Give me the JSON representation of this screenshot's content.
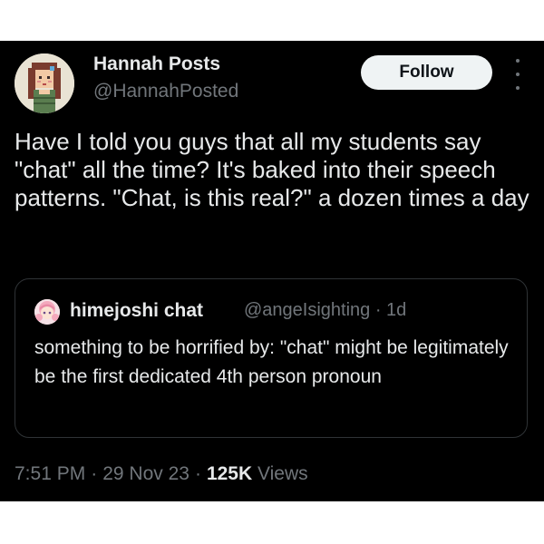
{
  "author": {
    "name": "Hannah Posts",
    "handle": "@HannahPosted",
    "avatar_icon": "pixel-art-avatar-icon"
  },
  "follow_label": "Follow",
  "more_icon": "more-vertical-icon",
  "text": "Have I told you guys that all my students say \"chat\" all the time? It's baked into their speech patterns. \"Chat, is this real?\" a dozen times a day",
  "quote": {
    "name": "himejoshi chat",
    "handle_time": "@angeIsighting · 1d",
    "text": "something to be horrified by: \"chat\" might be legitimately be the first dedicated 4th person pronoun",
    "avatar_icon": "anime-avatar-icon"
  },
  "meta": {
    "time": "7:51 PM",
    "date": "29 Nov 23",
    "views_count": "125K",
    "views_label": "Views",
    "sep": "·"
  },
  "colors": {
    "background": "#000000",
    "text": "#e7e9ea",
    "muted": "#71767b",
    "follow_bg": "#eff3f4",
    "border": "#2f3336"
  }
}
